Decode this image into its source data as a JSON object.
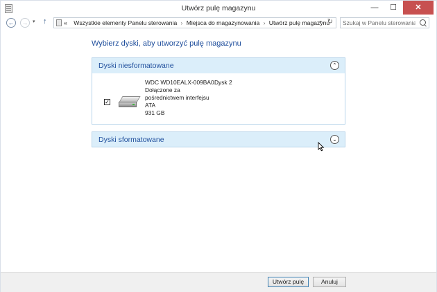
{
  "window": {
    "title": "Utwórz pulę magazynu",
    "min_glyph": "—",
    "max_glyph": "☐",
    "close_glyph": "✕"
  },
  "nav": {
    "back_glyph": "←",
    "forward_glyph": "→",
    "recent_glyph": "▾",
    "up_glyph": "↑",
    "address_prefix": "«",
    "breadcrumbs": [
      "Wszystkie elementy Panelu sterowania",
      "Miejsca do magazynowania",
      "Utwórz pulę magazynu"
    ],
    "separator_glyph": "›",
    "address_dropdown_glyph": "▾",
    "refresh_glyph": "↻",
    "search_placeholder": "Szukaj w Panelu sterowania"
  },
  "main": {
    "heading": "Wybierz dyski, aby utworzyć pulę magazynu",
    "sections": [
      {
        "title": "Dyski niesformatowane",
        "state": "expanded",
        "chevron_glyph": "⌃",
        "disks": [
          {
            "checked": true,
            "checkbox_glyph": "✓",
            "name": "WDC WD10EALX-009BA0...",
            "label": "Dysk 2",
            "connection_line1": "Dołączone za",
            "connection_line2": "pośrednictwem interfejsu",
            "bus": "ATA",
            "size": "931 GB"
          }
        ]
      },
      {
        "title": "Dyski sformatowane",
        "state": "collapsed",
        "chevron_glyph": "⌄"
      }
    ]
  },
  "footer": {
    "create_label": "Utwórz pulę",
    "cancel_label": "Anuluj"
  },
  "colors": {
    "heading": "#1f4e9c",
    "section_header_bg": "#dbeefa",
    "section_border": "#b7d4ea",
    "close_button": "#c75050"
  }
}
